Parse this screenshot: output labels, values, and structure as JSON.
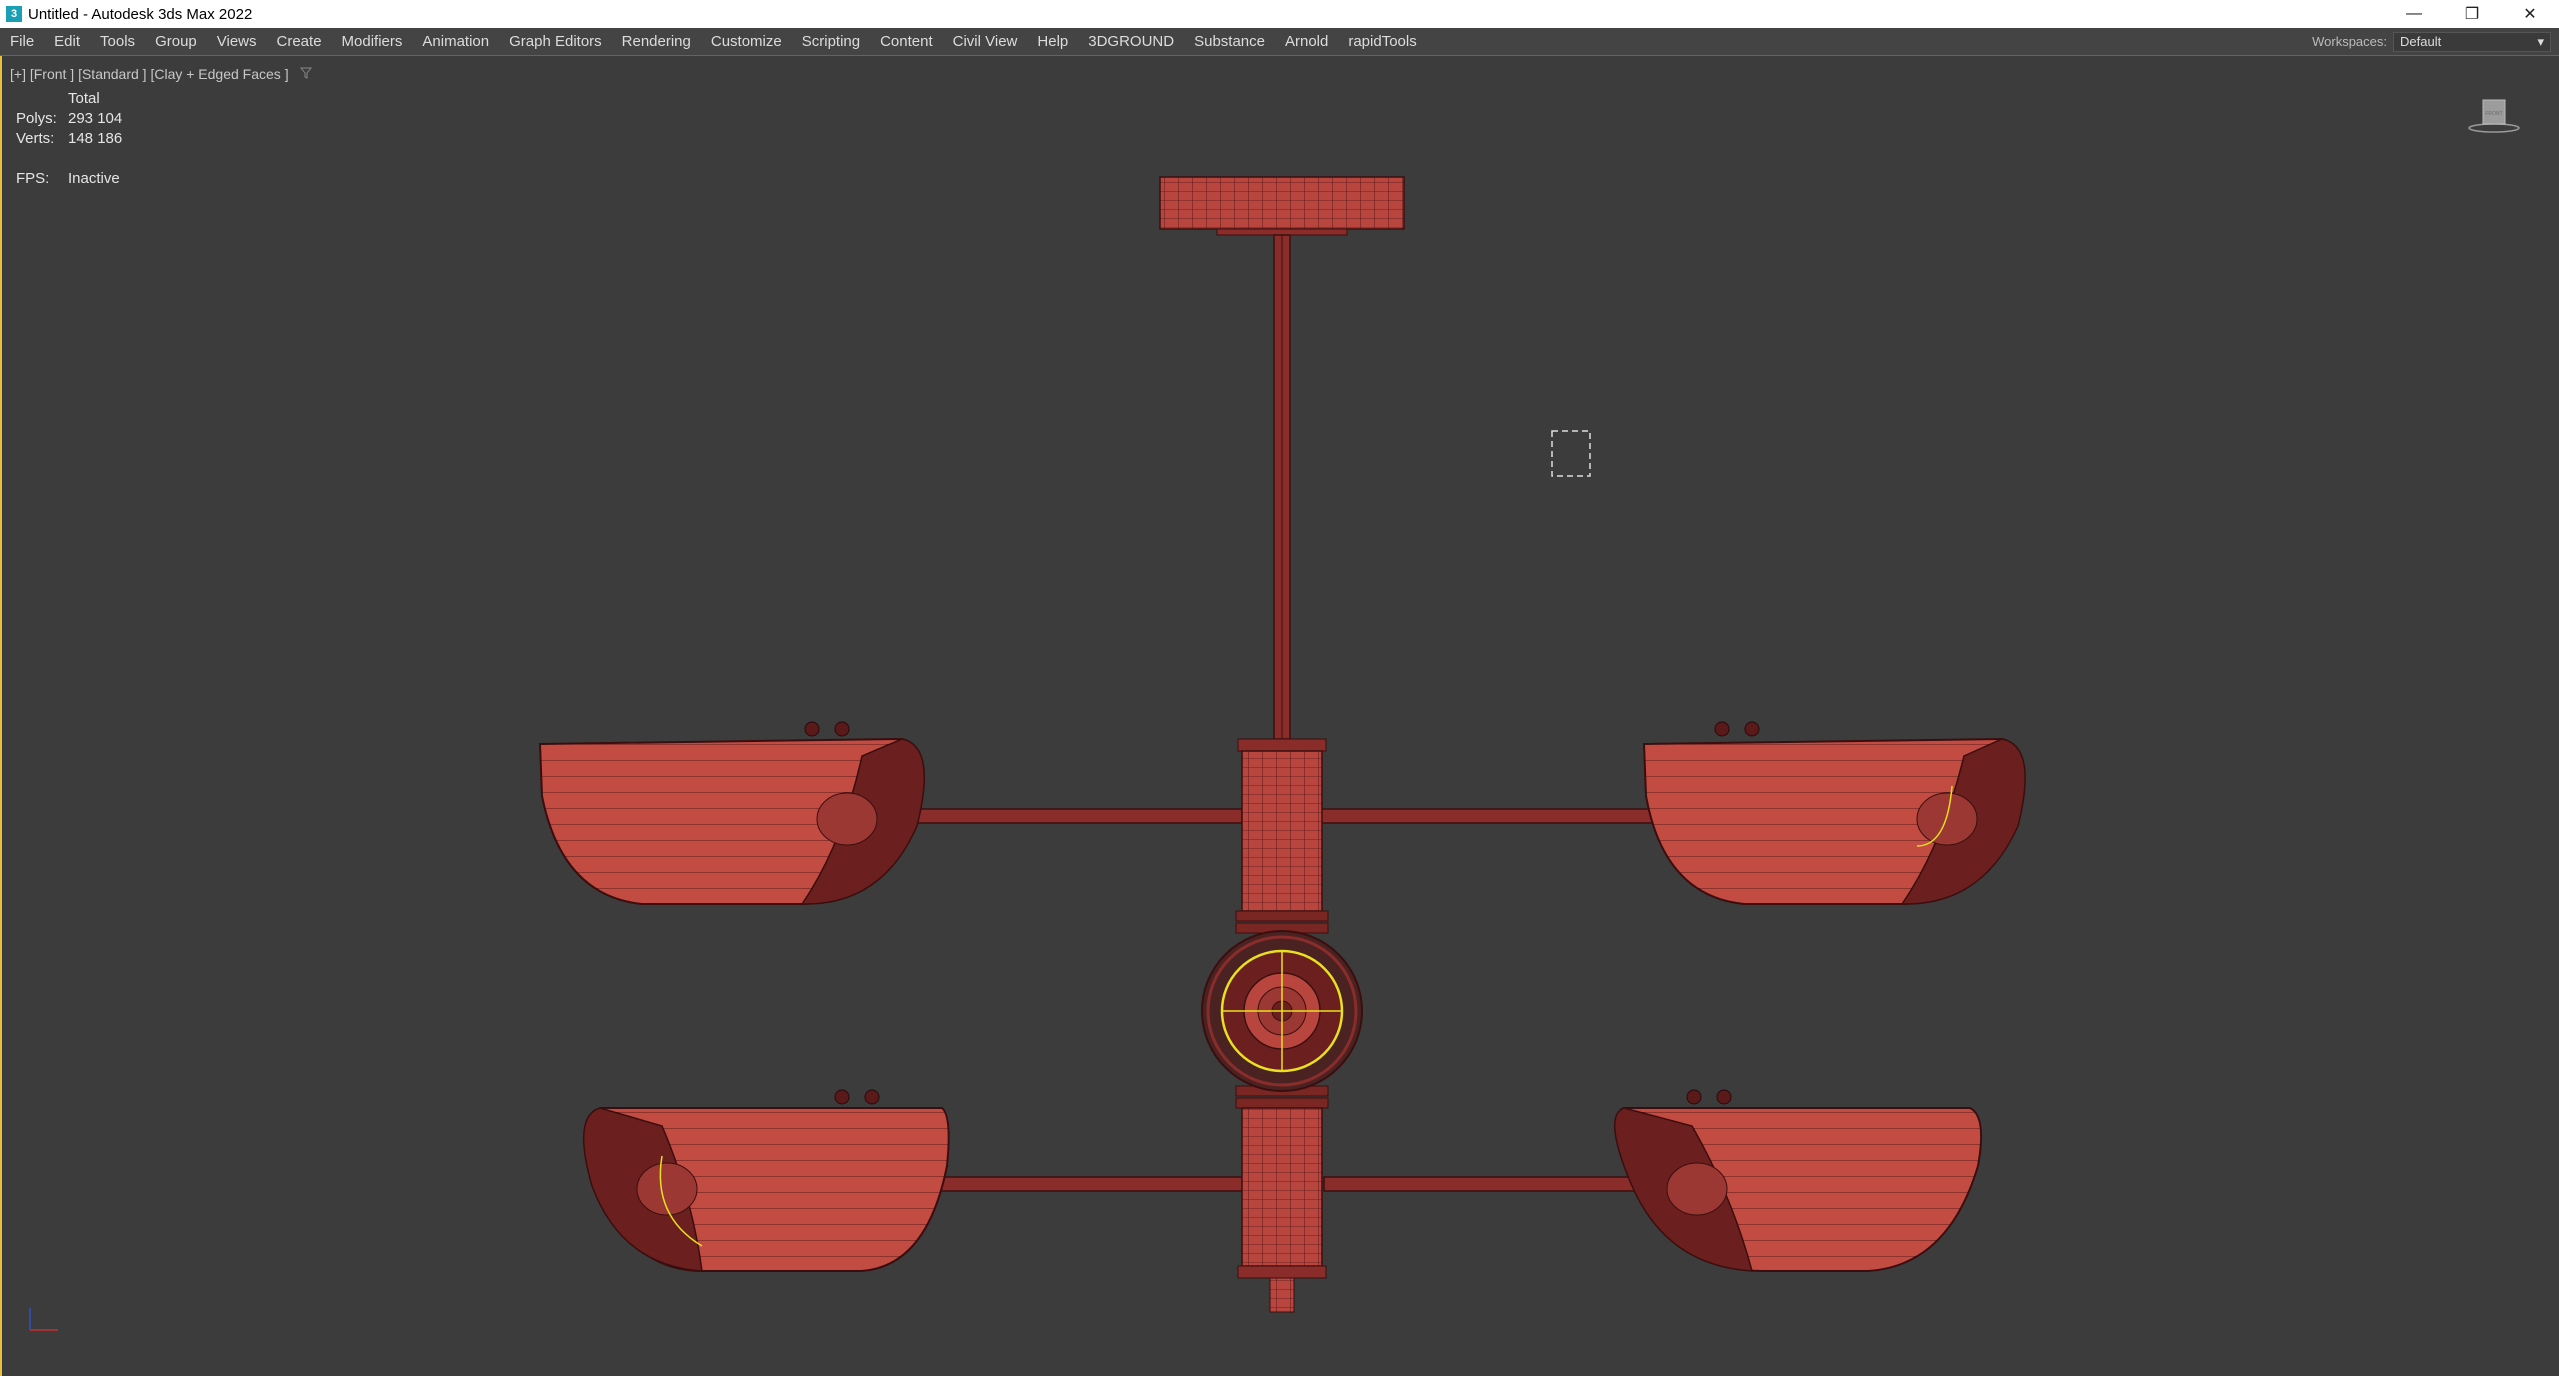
{
  "window": {
    "title": "Untitled - Autodesk 3ds Max 2022",
    "app_icon_glyph": "3",
    "controls": {
      "minimize": "—",
      "restore": "❐",
      "close": "✕"
    }
  },
  "menu": {
    "items": [
      "File",
      "Edit",
      "Tools",
      "Group",
      "Views",
      "Create",
      "Modifiers",
      "Animation",
      "Graph Editors",
      "Rendering",
      "Customize",
      "Scripting",
      "Content",
      "Civil View",
      "Help",
      "3DGROUND",
      "Substance",
      "Arnold",
      "rapidTools"
    ],
    "workspaces_label": "Workspaces:",
    "workspace_value": "Default"
  },
  "viewport": {
    "label": "[+] [Front ] [Standard ] [Clay + Edged Faces ]",
    "filter_icon": "funnel-icon",
    "stats": {
      "header": "Total",
      "polys_label": "Polys:",
      "polys_value": "293 104",
      "verts_label": "Verts:",
      "verts_value": "148 186",
      "fps_label": "FPS:",
      "fps_value": "Inactive"
    },
    "viewcube_label": "FRONT"
  },
  "colors": {
    "clay": "#b8453e",
    "clay_dark": "#6b1f1f",
    "wire": "#3a0e0e",
    "selection": "#e8e020",
    "viewport_bg": "#3c3c3c"
  }
}
